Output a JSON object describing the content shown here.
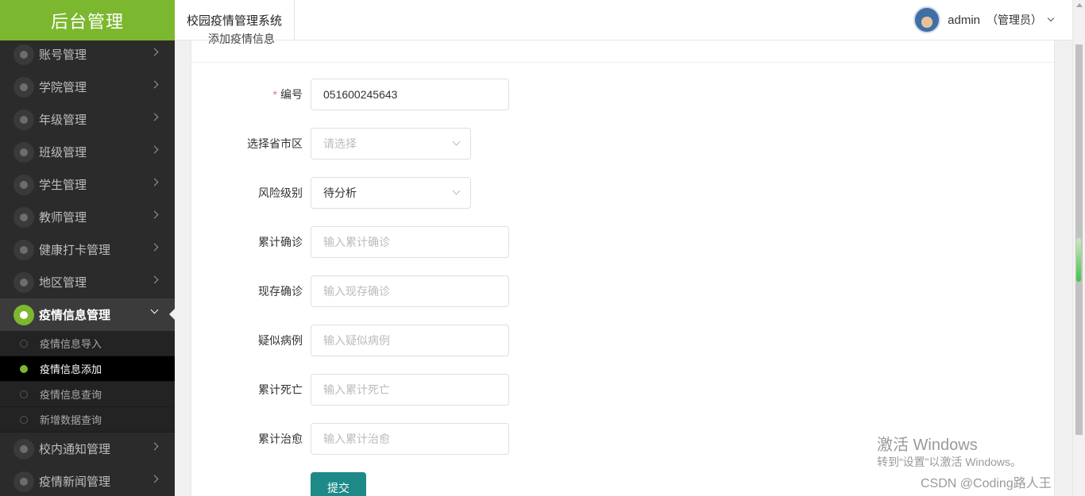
{
  "sidebar": {
    "brand": "后台管理",
    "menu_before": [
      {
        "label": "账号管理"
      },
      {
        "label": "学院管理"
      },
      {
        "label": "年级管理"
      },
      {
        "label": "班级管理"
      },
      {
        "label": "学生管理"
      },
      {
        "label": "教师管理"
      },
      {
        "label": "健康打卡管理"
      },
      {
        "label": "地区管理"
      }
    ],
    "active_menu": "疫情信息管理",
    "submenu": [
      {
        "label": "疫情信息导入"
      },
      {
        "label": "疫情信息添加"
      },
      {
        "label": "疫情信息查询"
      },
      {
        "label": "新增数据查询"
      }
    ],
    "menu_after": [
      {
        "label": "校内通知管理"
      },
      {
        "label": "疫情新闻管理"
      }
    ]
  },
  "header": {
    "system_title": "校园疫情管理系统",
    "username": "admin",
    "role": "（管理员）"
  },
  "card": {
    "title": "添加疫情信息"
  },
  "form": {
    "id": {
      "label": "编号",
      "required_mark": "*",
      "value": "051600245643"
    },
    "region": {
      "label": "选择省市区",
      "placeholder": "请选择"
    },
    "risk": {
      "label": "风险级别",
      "value": "待分析"
    },
    "total_confirmed": {
      "label": "累计确诊",
      "placeholder": "输入累计确诊"
    },
    "current_confirmed": {
      "label": "现存确诊",
      "placeholder": "输入现存确诊"
    },
    "suspected": {
      "label": "疑似病例",
      "placeholder": "输入疑似病例"
    },
    "total_deaths": {
      "label": "累计死亡",
      "placeholder": "输入累计死亡"
    },
    "total_cured": {
      "label": "累计治愈",
      "placeholder": "输入累计治愈"
    },
    "submit_label": "提交"
  },
  "watermark": {
    "activate_title": "激活 Windows",
    "activate_hint": "转到“设置”以激活 Windows。",
    "csdn": "CSDN @Coding路人王"
  }
}
